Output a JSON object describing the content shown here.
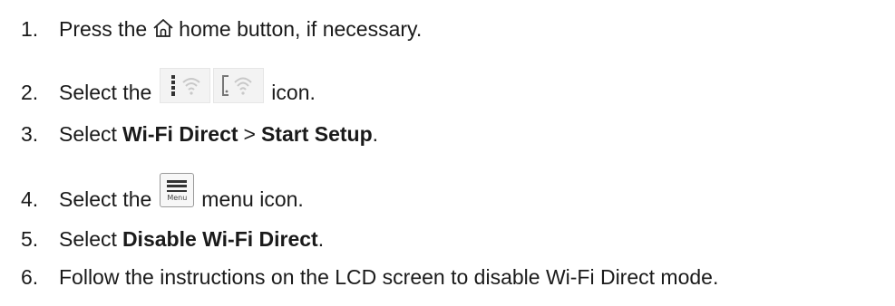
{
  "steps": [
    {
      "number": "1.",
      "before_icon": "Press the",
      "icon": "home-icon",
      "after_icon": "home button, if necessary."
    },
    {
      "number": "2.",
      "before_icon": "Select the",
      "icon": "wifi-status-icons",
      "after_icon": "icon."
    },
    {
      "number": "3.",
      "text_a": "Select",
      "bold_a": "Wi-Fi Direct",
      "sep": ">",
      "bold_b": "Start Setup",
      "end": "."
    },
    {
      "number": "4.",
      "before_icon": "Select the",
      "icon": "menu-icon",
      "icon_label": "Menu",
      "after_icon": "menu icon."
    },
    {
      "number": "5.",
      "text_a": "Select",
      "bold_a": "Disable Wi-Fi Direct",
      "end": "."
    },
    {
      "number": "6.",
      "text": "Follow the instructions on the LCD screen to disable Wi-Fi Direct mode."
    }
  ]
}
